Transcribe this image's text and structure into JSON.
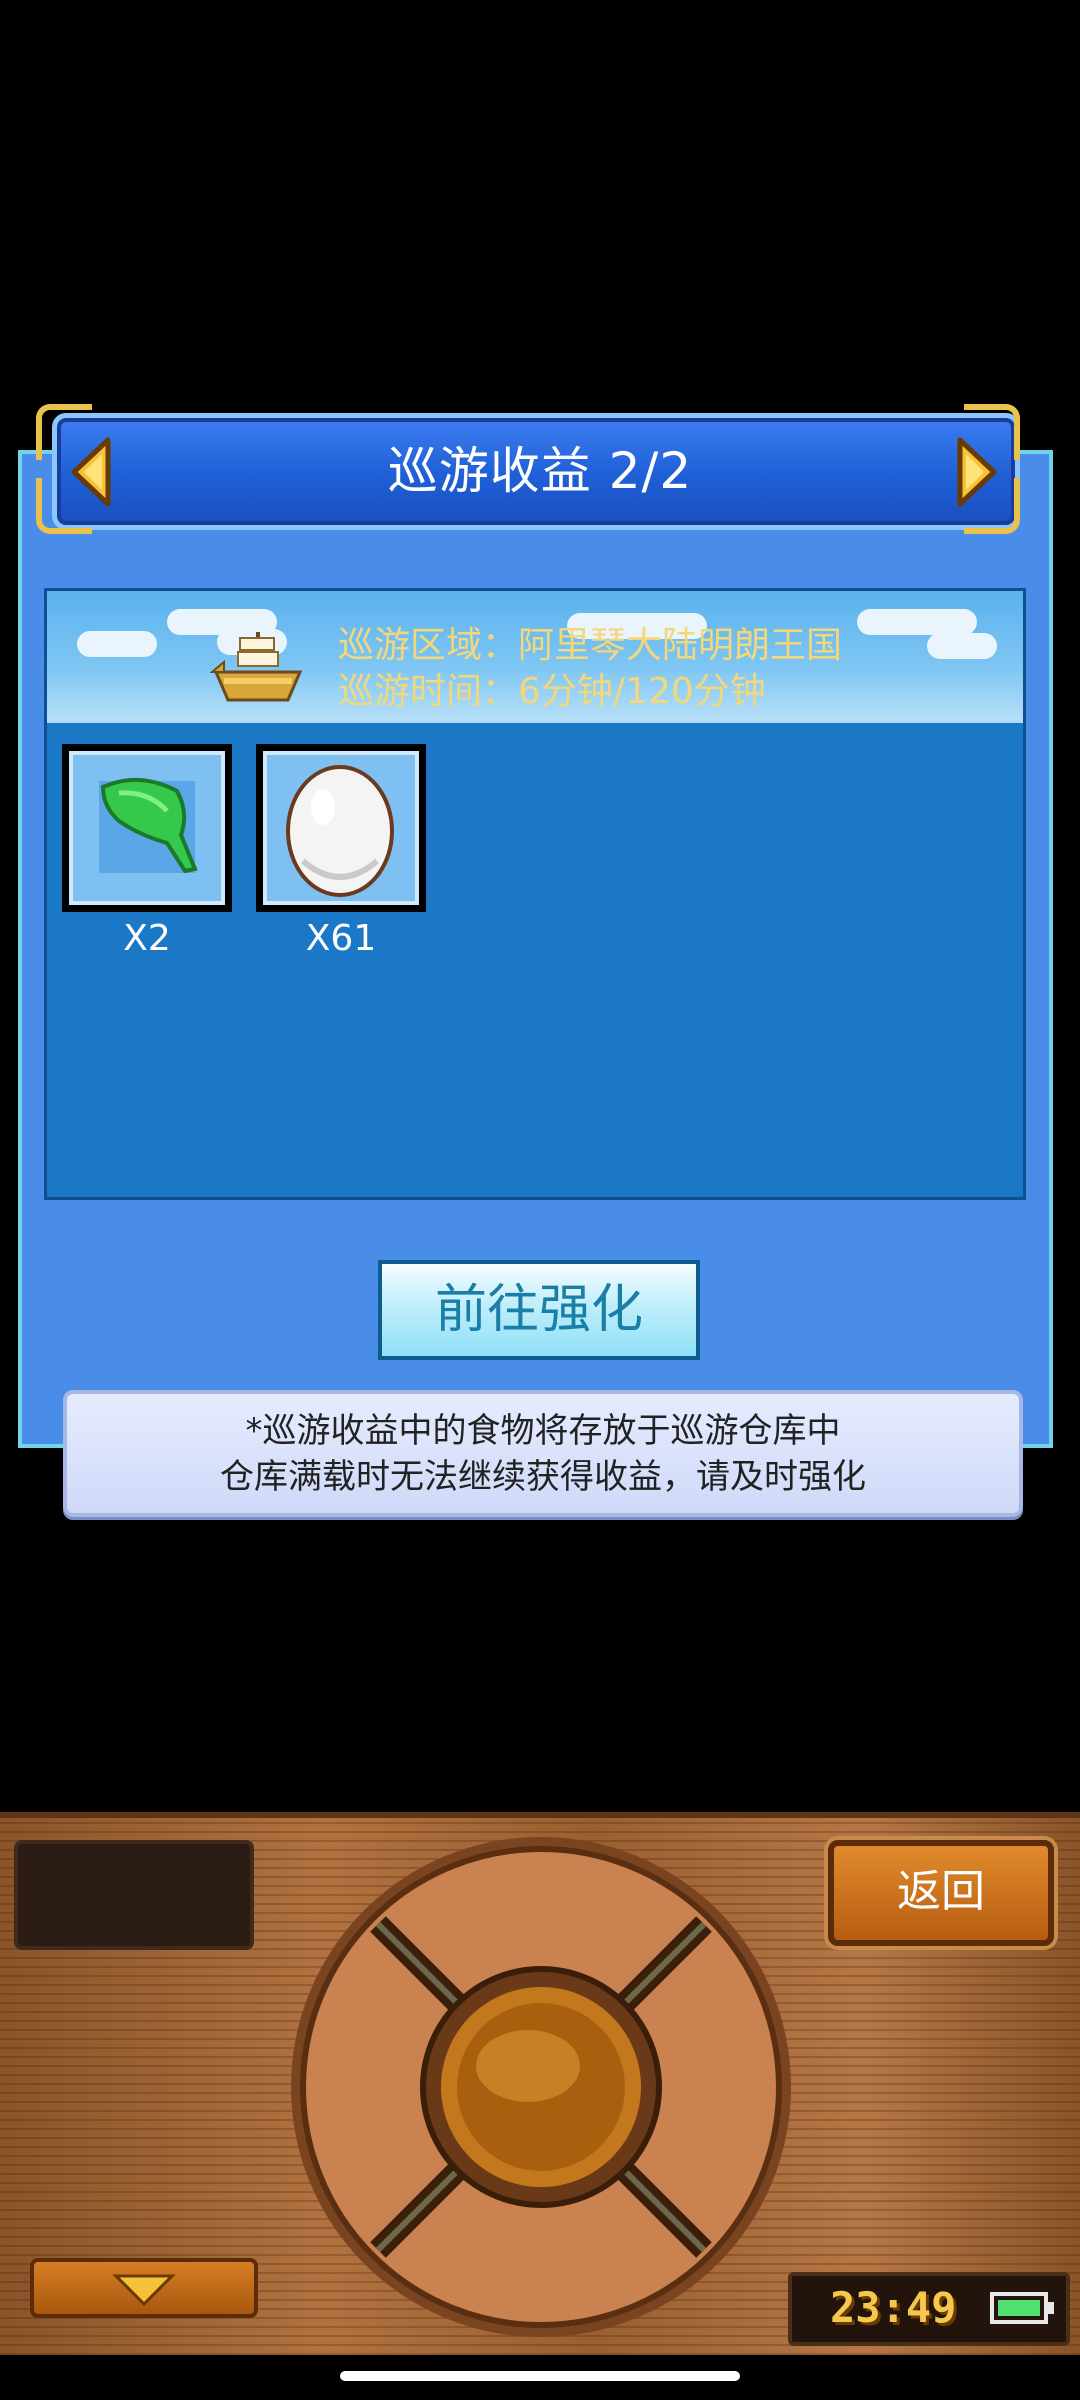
{
  "dialog": {
    "title": "巡游收益 2/2",
    "region_line": "巡游区域：阿里琴大陆明朗王国",
    "time_line": "巡游时间：6分钟/120分钟",
    "items": [
      {
        "icon": "green-leaf-icon",
        "count": "X2"
      },
      {
        "icon": "egg-icon",
        "count": "X61"
      }
    ],
    "strengthen_button": "前往强化",
    "notice_line1": "*巡游收益中的食物将存放于巡游仓库中",
    "notice_line2": "仓库满载时无法继续获得收益，请及时强化"
  },
  "controller": {
    "back_button": "返回",
    "clock": "23:49"
  },
  "colors": {
    "title_bar": "#1f5fd6",
    "info_text": "#f3d77a",
    "panel": "#1a78c6",
    "clock": "#f5c84c",
    "battery": "#4fe06f"
  }
}
